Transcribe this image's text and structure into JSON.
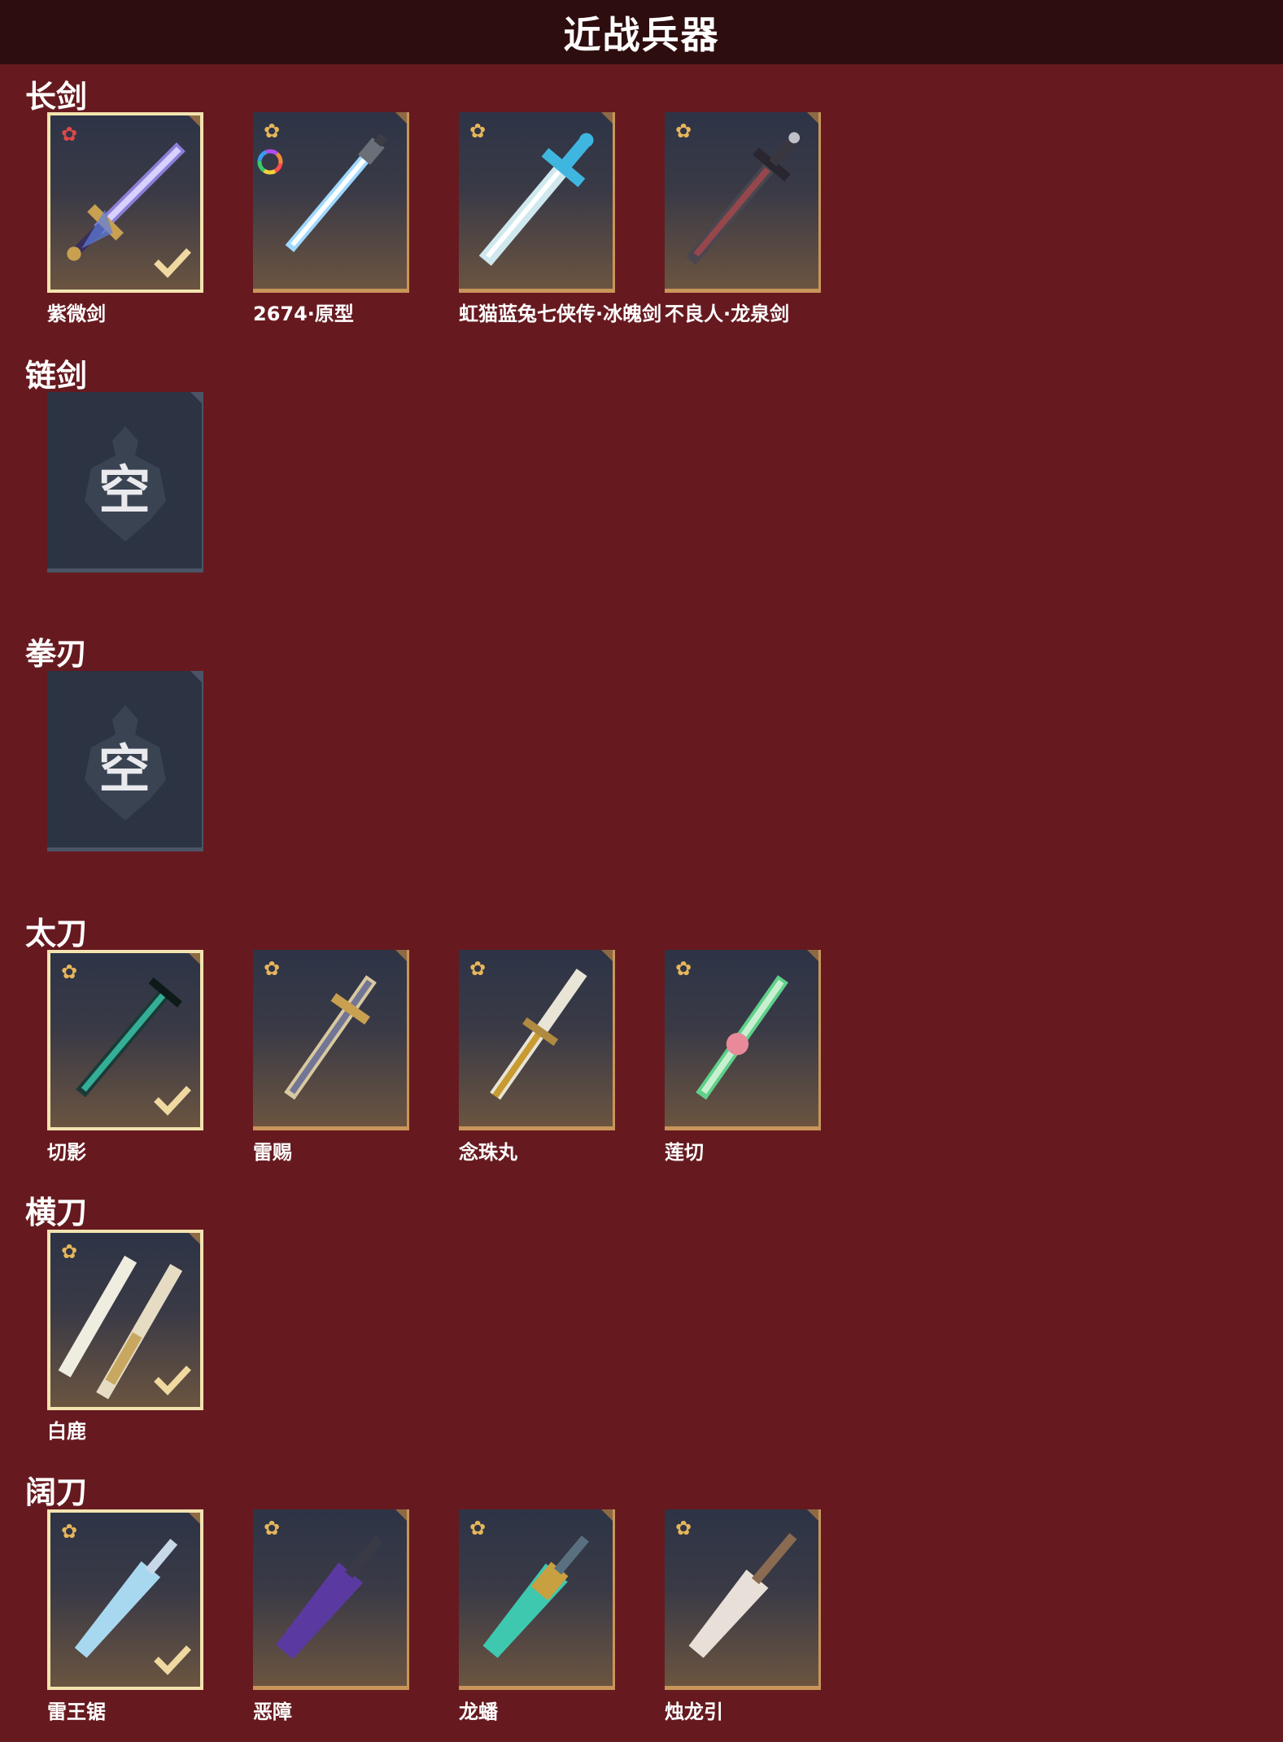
{
  "page_title": "近战兵器",
  "sections": [
    {
      "title": "长剑",
      "items": [
        {
          "name": "紫微剑",
          "rarity": "red-star",
          "selected": true
        },
        {
          "name": "2674·原型",
          "rarity": "gold-star",
          "selected": false
        },
        {
          "name": "虹猫蓝兔七侠传·冰魄剑",
          "rarity": "gold-star",
          "selected": false
        },
        {
          "name": "不良人·龙泉剑",
          "rarity": "gold-star",
          "selected": false
        }
      ]
    },
    {
      "title": "链剑",
      "empty_label": "空"
    },
    {
      "title": "拳刃",
      "empty_label": "空"
    },
    {
      "title": "太刀",
      "items": [
        {
          "name": "切影",
          "rarity": "gold-star",
          "selected": true
        },
        {
          "name": "雷赐",
          "rarity": "gold-star",
          "selected": false
        },
        {
          "name": "念珠丸",
          "rarity": "gold-star",
          "selected": false
        },
        {
          "name": "莲切",
          "rarity": "gold-star",
          "selected": false
        }
      ]
    },
    {
      "title": "横刀",
      "items": [
        {
          "name": "白鹿",
          "rarity": "gold-star",
          "selected": true
        }
      ]
    },
    {
      "title": "阔刀",
      "items": [
        {
          "name": "雷王锯",
          "rarity": "gold-star",
          "selected": true
        },
        {
          "name": "恶障",
          "rarity": "gold-star",
          "selected": false
        },
        {
          "name": "龙蟠",
          "rarity": "gold-star",
          "selected": false
        },
        {
          "name": "烛龙引",
          "rarity": "gold-star",
          "selected": false
        }
      ]
    }
  ],
  "colors": {
    "background": "#661a1f",
    "title_bar": "#2e0d0e",
    "card_border": "#c9955a",
    "selected_border": "#f3e3b0",
    "empty_card": "#2c3443",
    "gold_star": "#e8b65a",
    "red_star": "#e04848"
  },
  "icons": [
    "gold-star-icon",
    "red-star-icon",
    "color-wheel-icon",
    "checkmark-icon",
    "empty-slot-emblem-icon"
  ]
}
